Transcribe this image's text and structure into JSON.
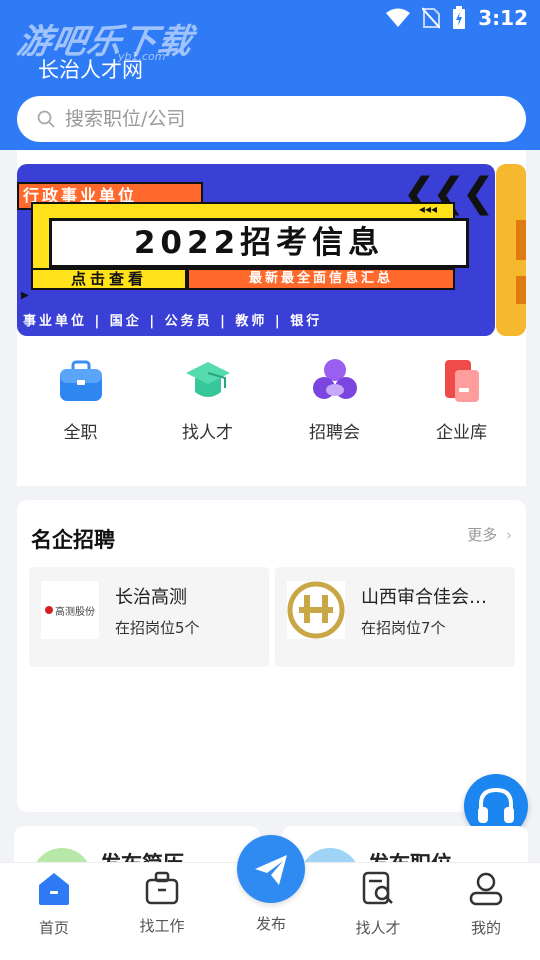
{
  "status_bar": {
    "time": "3:12"
  },
  "header": {
    "watermark": "游吧乐下载",
    "watermark_sub": "yb1.com",
    "title": "长治人才网",
    "search_placeholder": "搜索职位/公司"
  },
  "banner": {
    "tag": "行政事业单位",
    "title": "2022招考信息",
    "button_primary": "点击查看",
    "button_secondary": "最新最全面信息汇总",
    "bottom_line": "事业单位  |  国企  |  公务员  |  教师  |  银行"
  },
  "quick_nav": [
    {
      "label": "全职",
      "icon": "briefcase-icon"
    },
    {
      "label": "找人才",
      "icon": "graduation-cap-icon"
    },
    {
      "label": "招聘会",
      "icon": "people-group-icon"
    },
    {
      "label": "企业库",
      "icon": "company-card-icon"
    }
  ],
  "featured": {
    "title": "名企招聘",
    "more": "更多",
    "companies": [
      {
        "name": "长治高测",
        "jobs": "在招岗位5个",
        "logo_text": "高测股份"
      },
      {
        "name": "山西审合佳会…",
        "jobs": "在招岗位7个"
      }
    ]
  },
  "actions": {
    "post_resume": "发布简历",
    "post_job": "发布职位"
  },
  "tab_bar": {
    "items": [
      {
        "label": "首页",
        "icon": "home-icon"
      },
      {
        "label": "找工作",
        "icon": "job-bag-icon"
      },
      {
        "label": "发布",
        "icon": "send-icon"
      },
      {
        "label": "找人才",
        "icon": "resume-search-icon"
      },
      {
        "label": "我的",
        "icon": "user-icon"
      }
    ]
  },
  "colors": {
    "primary": "#2f7bf5",
    "banner_blue": "#3a3fd6",
    "banner_yellow": "#ffe21a",
    "banner_orange": "#ff6a2c"
  }
}
